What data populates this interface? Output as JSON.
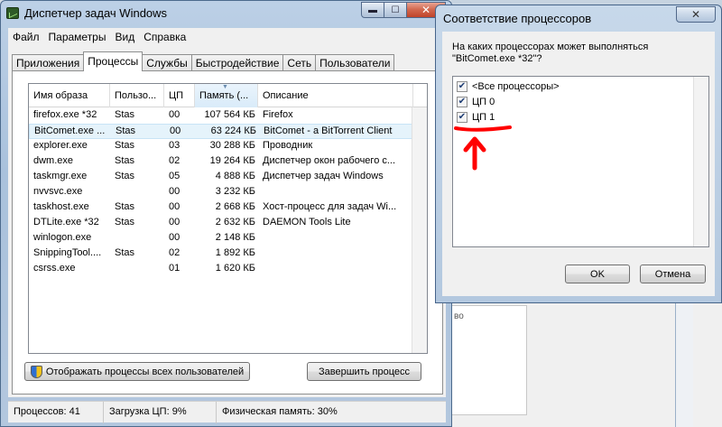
{
  "main_window": {
    "title": "Диспетчер задач Windows",
    "caption": {
      "minimize": "▬",
      "maximize": "☐",
      "close": "✕"
    },
    "menu": [
      "Файл",
      "Параметры",
      "Вид",
      "Справка"
    ],
    "tabs": [
      "Приложения",
      "Процессы",
      "Службы",
      "Быстродействие",
      "Сеть",
      "Пользователи"
    ],
    "active_tab": "Процессы"
  },
  "process_table": {
    "columns": {
      "name": "Имя образа",
      "user": "Пользо...",
      "cpu": "ЦП",
      "memory": "Память (...",
      "description": "Описание"
    },
    "rows": [
      {
        "name": "firefox.exe *32",
        "user": "Stas",
        "cpu": "00",
        "memory": "107 564 КБ",
        "description": "Firefox"
      },
      {
        "name": "BitComet.exe ...",
        "user": "Stas",
        "cpu": "00",
        "memory": "63 224 КБ",
        "description": "BitComet - a BitTorrent Client"
      },
      {
        "name": "explorer.exe",
        "user": "Stas",
        "cpu": "03",
        "memory": "30 288 КБ",
        "description": "Проводник"
      },
      {
        "name": "dwm.exe",
        "user": "Stas",
        "cpu": "02",
        "memory": "19 264 КБ",
        "description": "Диспетчер окон рабочего с..."
      },
      {
        "name": "taskmgr.exe",
        "user": "Stas",
        "cpu": "05",
        "memory": "4 888 КБ",
        "description": "Диспетчер задач Windows"
      },
      {
        "name": "nvvsvc.exe",
        "user": "",
        "cpu": "00",
        "memory": "3 232 КБ",
        "description": ""
      },
      {
        "name": "taskhost.exe",
        "user": "Stas",
        "cpu": "00",
        "memory": "2 668 КБ",
        "description": "Хост-процесс для задач Wi..."
      },
      {
        "name": "DTLite.exe *32",
        "user": "Stas",
        "cpu": "00",
        "memory": "2 632 КБ",
        "description": "DAEMON Tools Lite"
      },
      {
        "name": "winlogon.exe",
        "user": "",
        "cpu": "00",
        "memory": "2 148 КБ",
        "description": ""
      },
      {
        "name": "SnippingTool....",
        "user": "Stas",
        "cpu": "02",
        "memory": "1 892 КБ",
        "description": ""
      },
      {
        "name": "csrss.exe",
        "user": "",
        "cpu": "01",
        "memory": "1 620 КБ",
        "description": ""
      }
    ],
    "selected_row": 1
  },
  "buttons": {
    "show_all_users": "Отображать процессы всех пользователей",
    "end_process": "Завершить процесс"
  },
  "status_bar": {
    "processes": "Процессов: 41",
    "cpu_load": "Загрузка ЦП: 9%",
    "physical_memory": "Физическая память: 30%"
  },
  "affinity_dialog": {
    "title": "Соответствие процессоров",
    "close": "✕",
    "prompt": "На каких процессорах может выполняться \"BitComet.exe *32\"?",
    "items": [
      {
        "label": "<Все процессоры>",
        "checked": true
      },
      {
        "label": "ЦП 0",
        "checked": true
      },
      {
        "label": "ЦП 1",
        "checked": true
      }
    ],
    "ok": "OK",
    "cancel": "Отмена"
  },
  "background": {
    "fragment_text": "во"
  },
  "colors": {
    "annotation": "#ff0000",
    "selection": "#e5f3fb",
    "window_frame": "#bcd0e6"
  }
}
